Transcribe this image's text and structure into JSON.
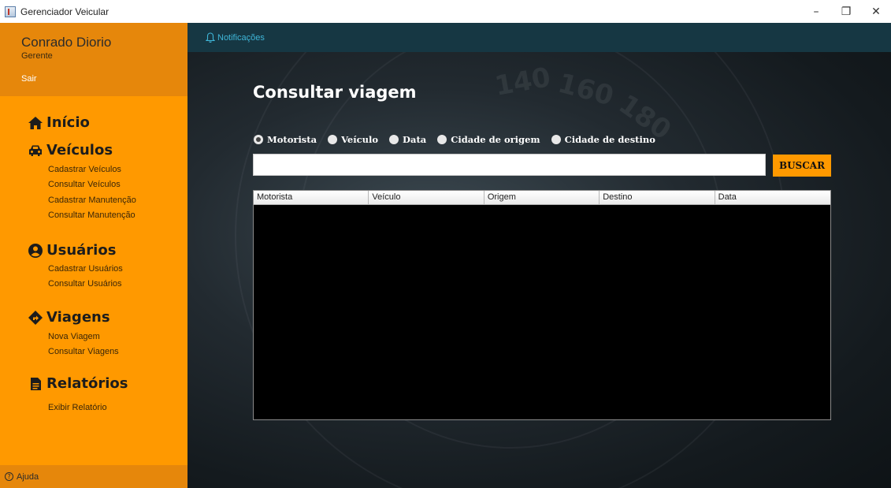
{
  "window": {
    "title": "Gerenciador Veicular",
    "controls": {
      "minimize": "–",
      "restore": "❐",
      "close": "✕"
    }
  },
  "sidebar": {
    "user_name": "Conrado Diorio",
    "user_role": "Gerente",
    "logout_label": "Sair",
    "sections": [
      {
        "label": "Início",
        "icon": "home-icon",
        "items": []
      },
      {
        "label": "Veículos",
        "icon": "car-icon",
        "items": [
          "Cadastrar Veículos",
          "Consultar Veículos",
          "Cadastrar Manutenção",
          "Consultar Manutenção"
        ]
      },
      {
        "label": "Usuários",
        "icon": "user-circle-icon",
        "items": [
          "Cadastrar Usuários",
          "Consultar Usuários"
        ]
      },
      {
        "label": "Viagens",
        "icon": "directions-icon",
        "items": [
          "Nova Viagem",
          "Consultar Viagens"
        ]
      },
      {
        "label": "Relatórios",
        "icon": "document-icon",
        "items": [
          "Exibir Relatório"
        ]
      }
    ],
    "help_label": "Ajuda"
  },
  "topbar": {
    "notifications_label": "Notificações",
    "icon": "bell-icon"
  },
  "main": {
    "title": "Consultar viagem",
    "filters": [
      {
        "label": "Motorista",
        "checked": true
      },
      {
        "label": "Veículo",
        "checked": false
      },
      {
        "label": "Data",
        "checked": false
      },
      {
        "label": "Cidade de origem",
        "checked": false
      },
      {
        "label": "Cidade de destino",
        "checked": false
      }
    ],
    "search": {
      "value": "",
      "button_label": "BUSCAR"
    },
    "table": {
      "columns": [
        "Motorista",
        "Veículo",
        "Origem",
        "Destino",
        "Data"
      ],
      "rows": []
    }
  },
  "colors": {
    "sidebar_bg": "#ff9900",
    "sidebar_header_bg": "#e6870b",
    "topbar_bg": "#163743",
    "notification_text": "#3fb6d8",
    "button_bg": "#ff9900"
  }
}
